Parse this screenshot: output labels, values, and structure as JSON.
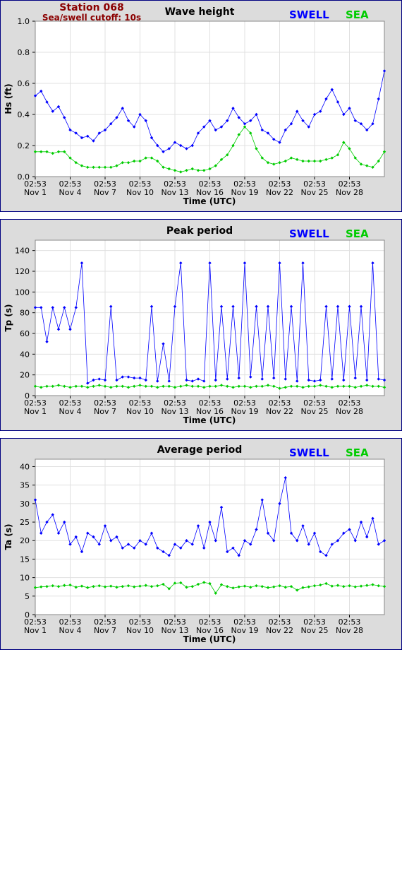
{
  "station": {
    "name": "Station 068",
    "cutoff": "Sea/swell cutoff: 10s"
  },
  "colors": {
    "swell": "#0000ff",
    "sea": "#00cc00",
    "station_text": "#8b0000",
    "panel_bg": "#dcdcdc",
    "panel_border": "#000080"
  },
  "legend": {
    "swell": "SWELL",
    "sea": "SEA"
  },
  "chart_data": [
    {
      "type": "line",
      "title": "Wave height",
      "xlabel": "Time (UTC)",
      "ylabel": "Hs (ft)",
      "xlim": [
        0,
        30
      ],
      "ylim": [
        0,
        1.0
      ],
      "yticks": [
        "0.0",
        "0.2",
        "0.4",
        "0.6",
        "0.8",
        "1.0"
      ],
      "xtick_times": [
        "02:53",
        "02:53",
        "02:53",
        "02:53",
        "02:53",
        "02:53",
        "02:53",
        "02:53",
        "02:53",
        "02:53"
      ],
      "xtick_dates": [
        "Nov 1",
        "Nov 4",
        "Nov 7",
        "Nov 10",
        "Nov 13",
        "Nov 16",
        "Nov 19",
        "Nov 22",
        "Nov 25",
        "Nov 28"
      ],
      "grid": true,
      "legend_position": "top-right",
      "series": [
        {
          "name": "SWELL",
          "x": [
            0,
            0.5,
            1,
            1.5,
            2,
            2.5,
            3,
            3.5,
            4,
            4.5,
            5,
            5.5,
            6,
            6.5,
            7,
            7.5,
            8,
            8.5,
            9,
            9.5,
            10,
            10.5,
            11,
            11.5,
            12,
            12.5,
            13,
            13.5,
            14,
            14.5,
            15,
            15.5,
            16,
            16.5,
            17,
            17.5,
            18,
            18.5,
            19,
            19.5,
            20,
            20.5,
            21,
            21.5,
            22,
            22.5,
            23,
            23.5,
            24,
            24.5,
            25,
            25.5,
            26,
            26.5,
            27,
            27.5,
            28,
            28.5,
            29,
            29.5,
            30
          ],
          "values": [
            0.52,
            0.55,
            0.48,
            0.42,
            0.45,
            0.38,
            0.3,
            0.28,
            0.25,
            0.26,
            0.23,
            0.28,
            0.3,
            0.34,
            0.38,
            0.44,
            0.36,
            0.32,
            0.4,
            0.36,
            0.25,
            0.2,
            0.16,
            0.18,
            0.22,
            0.2,
            0.18,
            0.2,
            0.28,
            0.32,
            0.36,
            0.3,
            0.32,
            0.36,
            0.44,
            0.38,
            0.34,
            0.36,
            0.4,
            0.3,
            0.28,
            0.24,
            0.22,
            0.3,
            0.34,
            0.42,
            0.36,
            0.32,
            0.4,
            0.42,
            0.5,
            0.56,
            0.48,
            0.4,
            0.44,
            0.36,
            0.34,
            0.3,
            0.34,
            0.5,
            0.68
          ]
        },
        {
          "name": "SEA",
          "x": [
            0,
            0.5,
            1,
            1.5,
            2,
            2.5,
            3,
            3.5,
            4,
            4.5,
            5,
            5.5,
            6,
            6.5,
            7,
            7.5,
            8,
            8.5,
            9,
            9.5,
            10,
            10.5,
            11,
            11.5,
            12,
            12.5,
            13,
            13.5,
            14,
            14.5,
            15,
            15.5,
            16,
            16.5,
            17,
            17.5,
            18,
            18.5,
            19,
            19.5,
            20,
            20.5,
            21,
            21.5,
            22,
            22.5,
            23,
            23.5,
            24,
            24.5,
            25,
            25.5,
            26,
            26.5,
            27,
            27.5,
            28,
            28.5,
            29,
            29.5,
            30
          ],
          "values": [
            0.16,
            0.16,
            0.16,
            0.15,
            0.16,
            0.16,
            0.12,
            0.09,
            0.07,
            0.06,
            0.06,
            0.06,
            0.06,
            0.06,
            0.07,
            0.09,
            0.09,
            0.1,
            0.1,
            0.12,
            0.12,
            0.1,
            0.06,
            0.05,
            0.04,
            0.03,
            0.04,
            0.05,
            0.04,
            0.04,
            0.05,
            0.07,
            0.11,
            0.14,
            0.2,
            0.27,
            0.32,
            0.28,
            0.18,
            0.12,
            0.09,
            0.08,
            0.09,
            0.1,
            0.12,
            0.11,
            0.1,
            0.1,
            0.1,
            0.1,
            0.11,
            0.12,
            0.14,
            0.22,
            0.18,
            0.12,
            0.08,
            0.07,
            0.06,
            0.1,
            0.16
          ]
        }
      ]
    },
    {
      "type": "line",
      "title": "Peak period",
      "xlabel": "Time (UTC)",
      "ylabel": "Tp (s)",
      "xlim": [
        0,
        30
      ],
      "ylim": [
        0,
        150
      ],
      "yticks": [
        "0",
        "20",
        "40",
        "60",
        "80",
        "100",
        "120",
        "140"
      ],
      "xtick_times": [
        "02:53",
        "02:53",
        "02:53",
        "02:53",
        "02:53",
        "02:53",
        "02:53",
        "02:53",
        "02:53",
        "02:53"
      ],
      "xtick_dates": [
        "Nov 1",
        "Nov 4",
        "Nov 7",
        "Nov 10",
        "Nov 13",
        "Nov 16",
        "Nov 19",
        "Nov 22",
        "Nov 25",
        "Nov 28"
      ],
      "grid": true,
      "legend_position": "top-right",
      "series": [
        {
          "name": "SWELL",
          "x": [
            0,
            0.5,
            1,
            1.5,
            2,
            2.5,
            3,
            3.5,
            4,
            4.5,
            5,
            5.5,
            6,
            6.5,
            7,
            7.5,
            8,
            8.5,
            9,
            9.5,
            10,
            10.5,
            11,
            11.5,
            12,
            12.5,
            13,
            13.5,
            14,
            14.5,
            15,
            15.5,
            16,
            16.5,
            17,
            17.5,
            18,
            18.5,
            19,
            19.5,
            20,
            20.5,
            21,
            21.5,
            22,
            22.5,
            23,
            23.5,
            24,
            24.5,
            25,
            25.5,
            26,
            26.5,
            27,
            27.5,
            28,
            28.5,
            29,
            29.5,
            30
          ],
          "values": [
            85,
            85,
            52,
            85,
            64,
            85,
            64,
            85,
            128,
            12,
            15,
            16,
            15,
            86,
            15,
            18,
            18,
            17,
            17,
            15,
            86,
            14,
            50,
            14,
            86,
            128,
            15,
            14,
            16,
            14,
            128,
            15,
            86,
            16,
            86,
            17,
            128,
            18,
            86,
            16,
            86,
            17,
            128,
            16,
            86,
            14,
            128,
            15,
            14,
            15,
            86,
            16,
            86,
            15,
            86,
            17,
            86,
            15,
            128,
            16,
            15
          ]
        },
        {
          "name": "SEA",
          "x": [
            0,
            0.5,
            1,
            1.5,
            2,
            2.5,
            3,
            3.5,
            4,
            4.5,
            5,
            5.5,
            6,
            6.5,
            7,
            7.5,
            8,
            8.5,
            9,
            9.5,
            10,
            10.5,
            11,
            11.5,
            12,
            12.5,
            13,
            13.5,
            14,
            14.5,
            15,
            15.5,
            16,
            16.5,
            17,
            17.5,
            18,
            18.5,
            19,
            19.5,
            20,
            20.5,
            21,
            21.5,
            22,
            22.5,
            23,
            23.5,
            24,
            24.5,
            25,
            25.5,
            26,
            26.5,
            27,
            27.5,
            28,
            28.5,
            29,
            29.5,
            30
          ],
          "values": [
            9,
            8,
            9,
            9,
            10,
            9,
            8,
            9,
            9,
            8,
            9,
            10,
            9,
            8,
            9,
            9,
            8,
            9,
            10,
            9,
            9,
            8,
            9,
            9,
            8,
            9,
            10,
            9,
            9,
            8,
            9,
            9,
            10,
            9,
            8,
            9,
            9,
            8,
            9,
            9,
            10,
            9,
            7,
            8,
            9,
            9,
            8,
            9,
            9,
            10,
            9,
            8,
            9,
            9,
            9,
            8,
            9,
            10,
            9,
            9,
            8
          ]
        }
      ]
    },
    {
      "type": "line",
      "title": "Average period",
      "xlabel": "Time (UTC)",
      "ylabel": "Ta (s)",
      "xlim": [
        0,
        30
      ],
      "ylim": [
        0,
        42
      ],
      "yticks": [
        "0",
        "5",
        "10",
        "15",
        "20",
        "25",
        "30",
        "35",
        "40"
      ],
      "xtick_times": [
        "02:53",
        "02:53",
        "02:53",
        "02:53",
        "02:53",
        "02:53",
        "02:53",
        "02:53",
        "02:53",
        "02:53"
      ],
      "xtick_dates": [
        "Nov 1",
        "Nov 4",
        "Nov 7",
        "Nov 10",
        "Nov 13",
        "Nov 16",
        "Nov 19",
        "Nov 22",
        "Nov 25",
        "Nov 28"
      ],
      "grid": true,
      "legend_position": "top-right",
      "series": [
        {
          "name": "SWELL",
          "x": [
            0,
            0.5,
            1,
            1.5,
            2,
            2.5,
            3,
            3.5,
            4,
            4.5,
            5,
            5.5,
            6,
            6.5,
            7,
            7.5,
            8,
            8.5,
            9,
            9.5,
            10,
            10.5,
            11,
            11.5,
            12,
            12.5,
            13,
            13.5,
            14,
            14.5,
            15,
            15.5,
            16,
            16.5,
            17,
            17.5,
            18,
            18.5,
            19,
            19.5,
            20,
            20.5,
            21,
            21.5,
            22,
            22.5,
            23,
            23.5,
            24,
            24.5,
            25,
            25.5,
            26,
            26.5,
            27,
            27.5,
            28,
            28.5,
            29,
            29.5,
            30
          ],
          "values": [
            31,
            22,
            25,
            27,
            22,
            25,
            19,
            21,
            17,
            22,
            21,
            19,
            24,
            20,
            21,
            18,
            19,
            18,
            20,
            19,
            22,
            18,
            17,
            16,
            19,
            18,
            20,
            19,
            24,
            18,
            25,
            20,
            29,
            17,
            18,
            16,
            20,
            19,
            23,
            31,
            22,
            20,
            30,
            37,
            22,
            20,
            24,
            19,
            22,
            17,
            16,
            19,
            20,
            22,
            23,
            20,
            25,
            21,
            26,
            19,
            20
          ]
        },
        {
          "name": "SEA",
          "x": [
            0,
            0.5,
            1,
            1.5,
            2,
            2.5,
            3,
            3.5,
            4,
            4.5,
            5,
            5.5,
            6,
            6.5,
            7,
            7.5,
            8,
            8.5,
            9,
            9.5,
            10,
            10.5,
            11,
            11.5,
            12,
            12.5,
            13,
            13.5,
            14,
            14.5,
            15,
            15.5,
            16,
            16.5,
            17,
            17.5,
            18,
            18.5,
            19,
            19.5,
            20,
            20.5,
            21,
            21.5,
            22,
            22.5,
            23,
            23.5,
            24,
            24.5,
            25,
            25.5,
            26,
            26.5,
            27,
            27.5,
            28,
            28.5,
            29,
            29.5,
            30
          ],
          "values": [
            7.3,
            7.5,
            7.6,
            7.8,
            7.6,
            7.9,
            8.0,
            7.4,
            7.7,
            7.3,
            7.6,
            7.8,
            7.5,
            7.7,
            7.4,
            7.6,
            7.8,
            7.5,
            7.7,
            7.9,
            7.6,
            7.8,
            8.2,
            7.0,
            8.5,
            8.6,
            7.4,
            7.6,
            8.2,
            8.7,
            8.4,
            5.8,
            8.1,
            7.6,
            7.2,
            7.5,
            7.7,
            7.4,
            7.8,
            7.6,
            7.3,
            7.5,
            7.8,
            7.4,
            7.6,
            6.6,
            7.3,
            7.5,
            7.8,
            8.0,
            8.4,
            7.7,
            7.9,
            7.6,
            7.8,
            7.5,
            7.7,
            7.9,
            8.1,
            7.8,
            7.6
          ]
        }
      ]
    }
  ]
}
